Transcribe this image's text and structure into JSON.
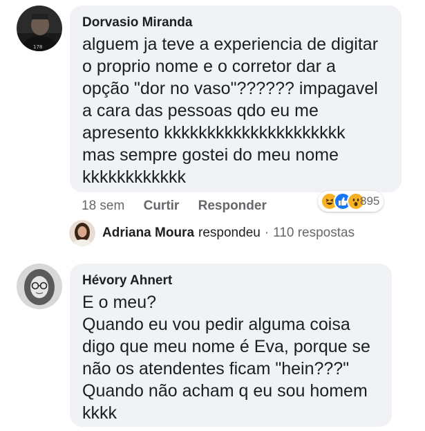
{
  "comments": [
    {
      "author": "Dorvasio Miranda",
      "text": "alguem ja teve a experiencia de digitar\no proprio nome e o corretor dar a\nopção \"dor no vaso\"?????? impagavel\na cara das pessoas qdo eu me\napresento kkkkkkkkkkkkkkkkkkkkk\nmas sempre gostei do meu nome\nkkkkkkkkkkkk",
      "timestamp": "18 sem",
      "like_label": "Curtir",
      "reply_label": "Responder",
      "reaction_count": "895",
      "reactions": [
        "haha-icon",
        "like-icon",
        "wow-icon"
      ]
    },
    {
      "author": "Hévory Ahnert",
      "text": "E o meu?\nQuando eu vou pedir alguma coisa\ndigo que meu nome é Eva, porque se\nnão os atendentes ficam \"hein???\"\nQuando não acham q eu sou homem\nkkkk"
    }
  ],
  "reply_summary": {
    "author": "Adriana Moura",
    "verb": "respondeu",
    "separator": "·",
    "count_text": "110 respostas"
  },
  "colors": {
    "bubble": "#f0f2f5",
    "secondary_text": "#65676b",
    "like_blue": "#1877f2",
    "reaction_yellow": "#f7b125"
  }
}
